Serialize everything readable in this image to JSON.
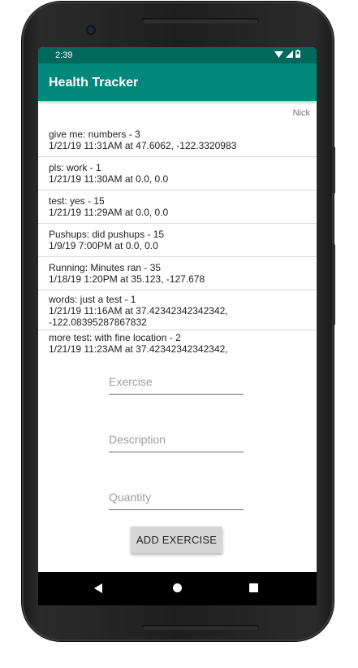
{
  "status": {
    "time": "2:39",
    "icons": [
      "wifi-icon",
      "signal-icon",
      "battery-icon"
    ]
  },
  "app": {
    "title": "Health Tracker",
    "user": "Nick",
    "colors": {
      "appbar": "#00897b",
      "statusbar": "#00695c"
    }
  },
  "entries": [
    {
      "line1": "give me: numbers - 3",
      "line2": "1/21/19 11:31AM at 47.6062, -122.3320983",
      "line3": ""
    },
    {
      "line1": "pls: work - 1",
      "line2": "1/21/19 11:30AM at 0.0, 0.0",
      "line3": ""
    },
    {
      "line1": "test: yes - 15",
      "line2": "1/21/19 11:29AM at 0.0, 0.0",
      "line3": ""
    },
    {
      "line1": "Pushups: did pushups - 15",
      "line2": "1/9/19 7:00PM at 0.0, 0.0",
      "line3": ""
    },
    {
      "line1": "Running: Minutes ran - 35",
      "line2": "1/18/19 1:20PM at 35.123, -127.678",
      "line3": ""
    },
    {
      "line1": "words: just a test - 1",
      "line2": "1/21/19 11:16AM at 37.42342342342342,",
      "line3": "-122.08395287867832"
    },
    {
      "line1": "more test: with fine location - 2",
      "line2": "1/21/19 11:23AM at 37.42342342342342,",
      "line3": ""
    }
  ],
  "form": {
    "exercise": {
      "placeholder": "Exercise",
      "value": ""
    },
    "description": {
      "placeholder": "Description",
      "value": ""
    },
    "quantity": {
      "placeholder": "Quantity",
      "value": ""
    },
    "add_label": "ADD EXERCISE"
  },
  "navbar": {
    "icons": [
      "back-icon",
      "home-icon",
      "recents-icon"
    ]
  }
}
